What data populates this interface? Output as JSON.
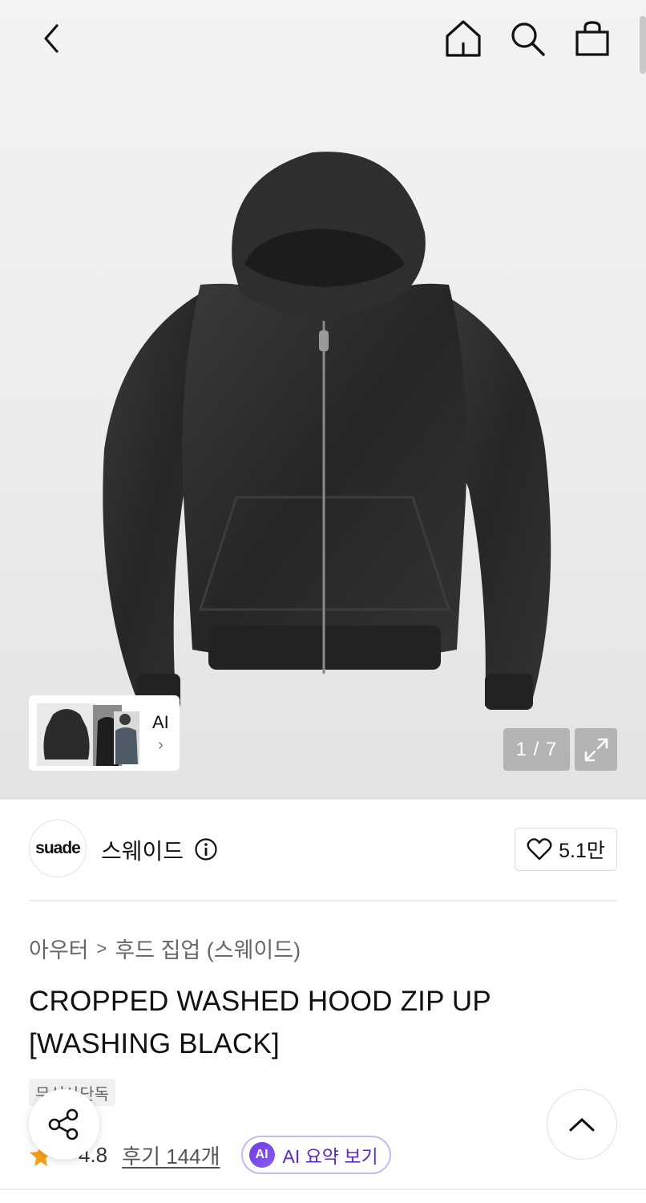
{
  "icons": {
    "back": "chevron-left-icon",
    "home": "home-icon",
    "search": "search-icon",
    "cart": "shopping-bag-icon",
    "expand": "expand-icon",
    "info": "info-icon",
    "heart": "heart-icon",
    "star": "star-icon",
    "share": "share-icon",
    "scroll_top": "chevron-up-icon"
  },
  "gallery": {
    "ai_label": "AI",
    "ai_chevron": "›",
    "pager": "1 / 7"
  },
  "brand": {
    "logo_text": "suade",
    "name": "스웨이드",
    "likes": "5.1만"
  },
  "breadcrumb": {
    "category": "아우터",
    "separator": ">",
    "subcategory": "후드 집업 (스웨이드)"
  },
  "product": {
    "title": "CROPPED WASHED HOOD ZIP UP [WASHING BLACK]",
    "badge": "무신사단독"
  },
  "rating": {
    "value": "4.8",
    "reviews": "후기 144개",
    "ai_badge": "AI",
    "ai_summary": "AI 요약 보기"
  },
  "colors": {
    "accent_purple": "#5b2bc4",
    "star_orange": "#f5a11c",
    "jacket": "#2a2a2a"
  }
}
